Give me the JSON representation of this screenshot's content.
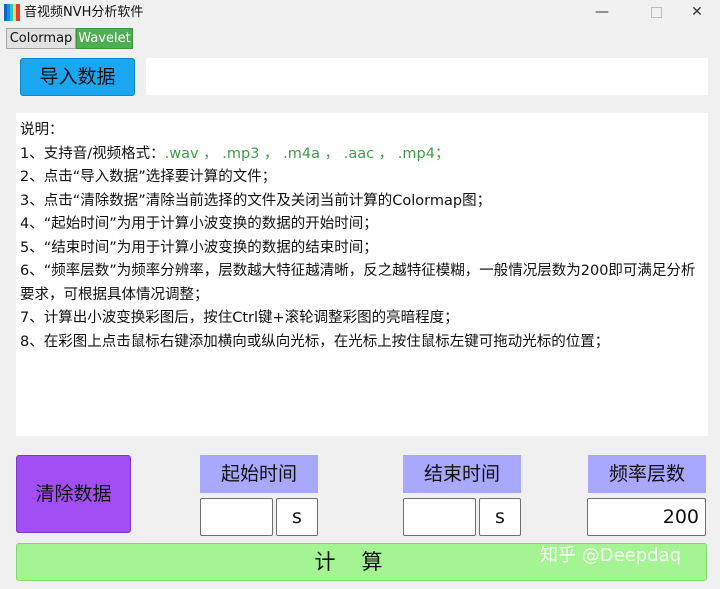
{
  "window": {
    "title": "音视频NVH分析软件",
    "controls": {
      "minimize": "—",
      "close": "✕"
    }
  },
  "tabs": [
    {
      "label": "Colormap",
      "active": false
    },
    {
      "label": "Wavelet",
      "active": true,
      "color": "#4caf50"
    }
  ],
  "import_button": {
    "label": "导入数据",
    "color": "#1aa6f0"
  },
  "file_path": {
    "value": ""
  },
  "description": {
    "heading": "说明：",
    "line1_prefix": "1、支持音/视频格式：",
    "line1_formats": ".wav ， .mp3 ， .m4a ， .aac ， .mp4；",
    "line2": "2、点击“导入数据”选择要计算的文件；",
    "line3": "3、点击“清除数据”清除当前选择的文件及关闭当前计算的Colormap图；",
    "line4": "4、“起始时间”为用于计算小波变换的数据的开始时间；",
    "line5": "5、“结束时间”为用于计算小波变换的数据的结束时间；",
    "line6": "6、“频率层数”为频率分辨率，层数越大特征越清晰，反之越特征模糊，一般情况层数为200即可满足分析要求，可根据具体情况调整；",
    "line7": "7、计算出小波变换彩图后，按住Ctrl键+滚轮调整彩图的亮暗程度；",
    "line8": "8、在彩图上点击鼠标右键添加横向或纵向光标，在光标上按住鼠标左键可拖动光标的位置；"
  },
  "clear_button": {
    "label": "清除数据",
    "color": "#a24ef5"
  },
  "params": {
    "start_time": {
      "label": "起始时间",
      "value": "",
      "unit": "s"
    },
    "end_time": {
      "label": "结束时间",
      "value": "",
      "unit": "s"
    },
    "freq_levels": {
      "label": "频率层数",
      "value": "200"
    }
  },
  "calc_button": {
    "label": "计算",
    "color": "#a4f493"
  },
  "watermark": "知乎 @Deepdaq"
}
